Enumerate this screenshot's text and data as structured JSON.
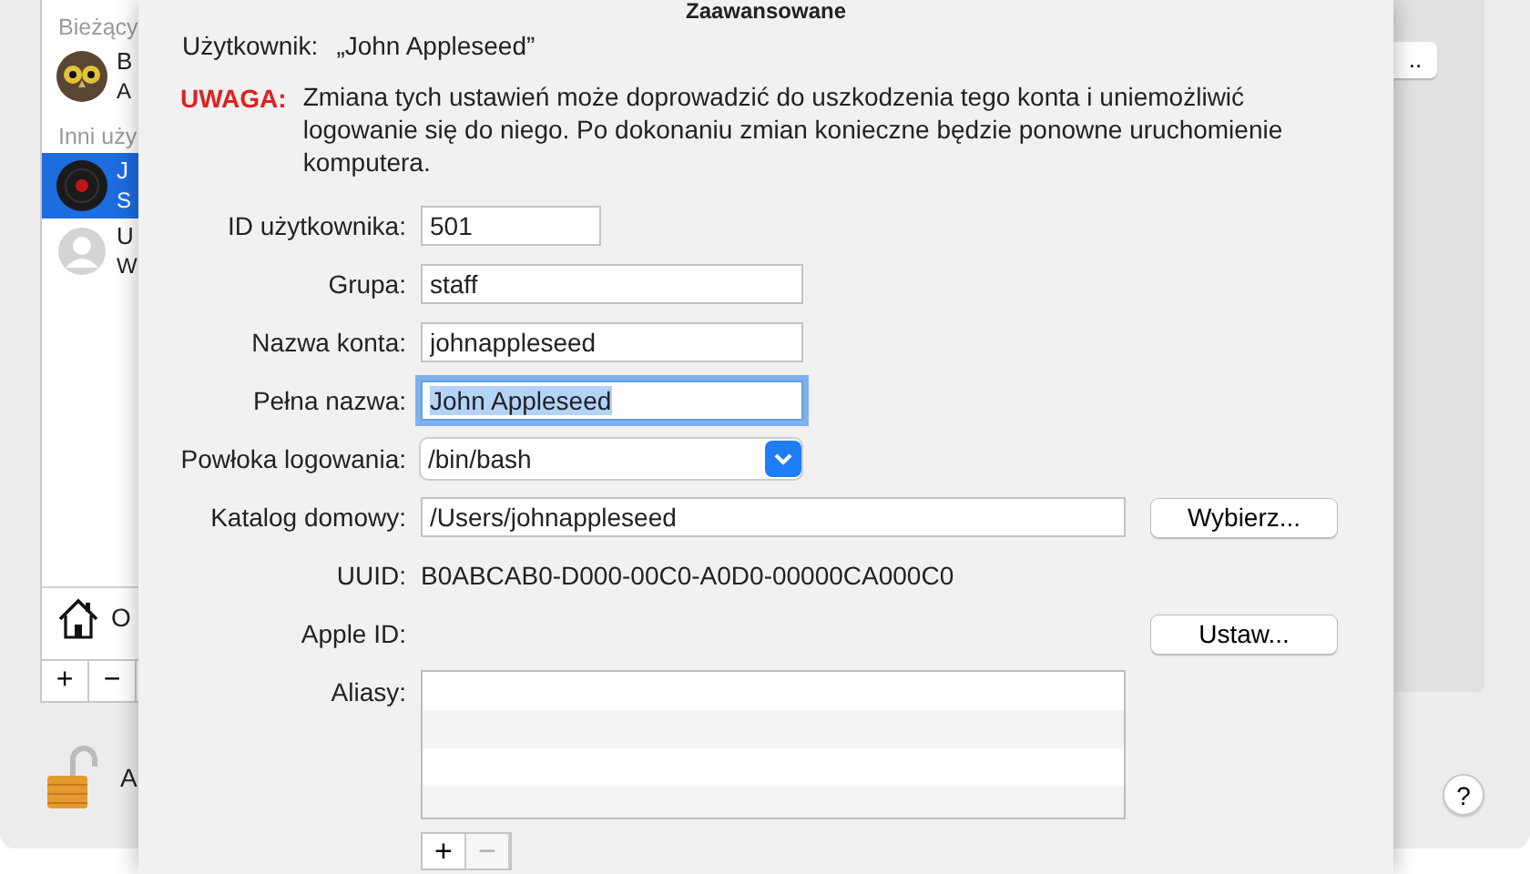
{
  "background_window": {
    "sidebar": {
      "sections": [
        {
          "header": "Bieżący",
          "users": [
            {
              "name": "B",
              "subtitle": "A",
              "kind": "owl",
              "selected": false
            }
          ]
        },
        {
          "header": "Inni uży",
          "users": [
            {
              "name": "J",
              "subtitle": "S",
              "kind": "record",
              "selected": true
            },
            {
              "name": "U",
              "subtitle": "W",
              "kind": "generic",
              "selected": false
            }
          ]
        }
      ],
      "login_options": "O",
      "add_button": "+",
      "remove_button": "−"
    },
    "lock_label": "A",
    "top_button": "..",
    "help_button": "?"
  },
  "dialog": {
    "title": "Zaawansowane",
    "user_label": "Użytkownik:",
    "user_value": "„John Appleseed”",
    "warning_label": "UWAGA:",
    "warning_text": "Zmiana tych ustawień może doprowadzić do uszkodzenia tego konta i uniemożliwić logowanie się do niego. Po dokonaniu zmian konieczne będzie ponowne uruchomienie komputera.",
    "fields": [
      {
        "kind": "text",
        "label": "ID użytkownika:",
        "value": "501",
        "focused": false
      },
      {
        "kind": "text",
        "label": "Grupa:",
        "value": "staff",
        "focused": false
      },
      {
        "kind": "text",
        "label": "Nazwa konta:",
        "value": "johnappleseed",
        "focused": false
      },
      {
        "kind": "text",
        "label": "Pełna nazwa:",
        "value": "John Appleseed",
        "focused": true
      },
      {
        "kind": "select",
        "label": "Powłoka logowania:",
        "value": "/bin/bash"
      },
      {
        "kind": "text_button",
        "label": "Katalog domowy:",
        "value": "/Users/johnappleseed",
        "focused": false,
        "button": "Wybierz..."
      },
      {
        "kind": "static",
        "label": "UUID:",
        "value": "B0ABCAB0-D000-00C0-A0D0-00000CA000C0"
      },
      {
        "kind": "button",
        "label": "Apple ID:",
        "button": "Ustaw..."
      },
      {
        "kind": "list",
        "label": "Aliasy:",
        "add_button": "+",
        "remove_button": "−",
        "remove_disabled": true
      }
    ]
  }
}
